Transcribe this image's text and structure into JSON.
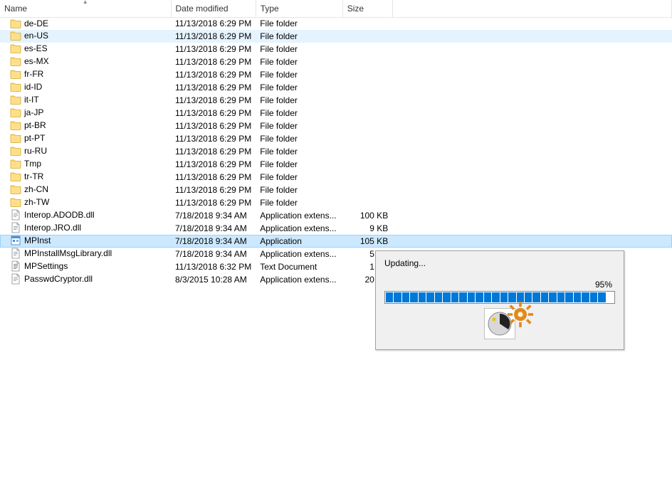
{
  "columns": {
    "name": "Name",
    "date": "Date modified",
    "type": "Type",
    "size": "Size"
  },
  "rows": [
    {
      "icon": "folder",
      "name": "de-DE",
      "date": "11/13/2018 6:29 PM",
      "type": "File folder",
      "size": "",
      "state": ""
    },
    {
      "icon": "folder",
      "name": "en-US",
      "date": "11/13/2018 6:29 PM",
      "type": "File folder",
      "size": "",
      "state": "hover"
    },
    {
      "icon": "folder",
      "name": "es-ES",
      "date": "11/13/2018 6:29 PM",
      "type": "File folder",
      "size": "",
      "state": ""
    },
    {
      "icon": "folder",
      "name": "es-MX",
      "date": "11/13/2018 6:29 PM",
      "type": "File folder",
      "size": "",
      "state": ""
    },
    {
      "icon": "folder",
      "name": "fr-FR",
      "date": "11/13/2018 6:29 PM",
      "type": "File folder",
      "size": "",
      "state": ""
    },
    {
      "icon": "folder",
      "name": "id-ID",
      "date": "11/13/2018 6:29 PM",
      "type": "File folder",
      "size": "",
      "state": ""
    },
    {
      "icon": "folder",
      "name": "it-IT",
      "date": "11/13/2018 6:29 PM",
      "type": "File folder",
      "size": "",
      "state": ""
    },
    {
      "icon": "folder",
      "name": "ja-JP",
      "date": "11/13/2018 6:29 PM",
      "type": "File folder",
      "size": "",
      "state": ""
    },
    {
      "icon": "folder",
      "name": "pt-BR",
      "date": "11/13/2018 6:29 PM",
      "type": "File folder",
      "size": "",
      "state": ""
    },
    {
      "icon": "folder",
      "name": "pt-PT",
      "date": "11/13/2018 6:29 PM",
      "type": "File folder",
      "size": "",
      "state": ""
    },
    {
      "icon": "folder",
      "name": "ru-RU",
      "date": "11/13/2018 6:29 PM",
      "type": "File folder",
      "size": "",
      "state": ""
    },
    {
      "icon": "folder",
      "name": "Tmp",
      "date": "11/13/2018 6:29 PM",
      "type": "File folder",
      "size": "",
      "state": ""
    },
    {
      "icon": "folder",
      "name": "tr-TR",
      "date": "11/13/2018 6:29 PM",
      "type": "File folder",
      "size": "",
      "state": ""
    },
    {
      "icon": "folder",
      "name": "zh-CN",
      "date": "11/13/2018 6:29 PM",
      "type": "File folder",
      "size": "",
      "state": ""
    },
    {
      "icon": "folder",
      "name": "zh-TW",
      "date": "11/13/2018 6:29 PM",
      "type": "File folder",
      "size": "",
      "state": ""
    },
    {
      "icon": "file",
      "name": "Interop.ADODB.dll",
      "date": "7/18/2018 9:34 AM",
      "type": "Application extens...",
      "size": "100 KB",
      "state": ""
    },
    {
      "icon": "file",
      "name": "Interop.JRO.dll",
      "date": "7/18/2018 9:34 AM",
      "type": "Application extens...",
      "size": "9 KB",
      "state": ""
    },
    {
      "icon": "app",
      "name": "MPInst",
      "date": "7/18/2018 9:34 AM",
      "type": "Application",
      "size": "105 KB",
      "state": "selected"
    },
    {
      "icon": "file",
      "name": "MPInstallMsgLibrary.dll",
      "date": "7/18/2018 9:34 AM",
      "type": "Application extens...",
      "size": "5 KB",
      "state": ""
    },
    {
      "icon": "text",
      "name": "MPSettings",
      "date": "11/13/2018 6:32 PM",
      "type": "Text Document",
      "size": "1 KB",
      "state": ""
    },
    {
      "icon": "file",
      "name": "PasswdCryptor.dll",
      "date": "8/3/2015 10:28 AM",
      "type": "Application extens...",
      "size": "20 KB",
      "state": ""
    }
  ],
  "dialog": {
    "title": "Updating...",
    "percent": "95%",
    "segments_total": 28,
    "segments_filled": 27
  }
}
